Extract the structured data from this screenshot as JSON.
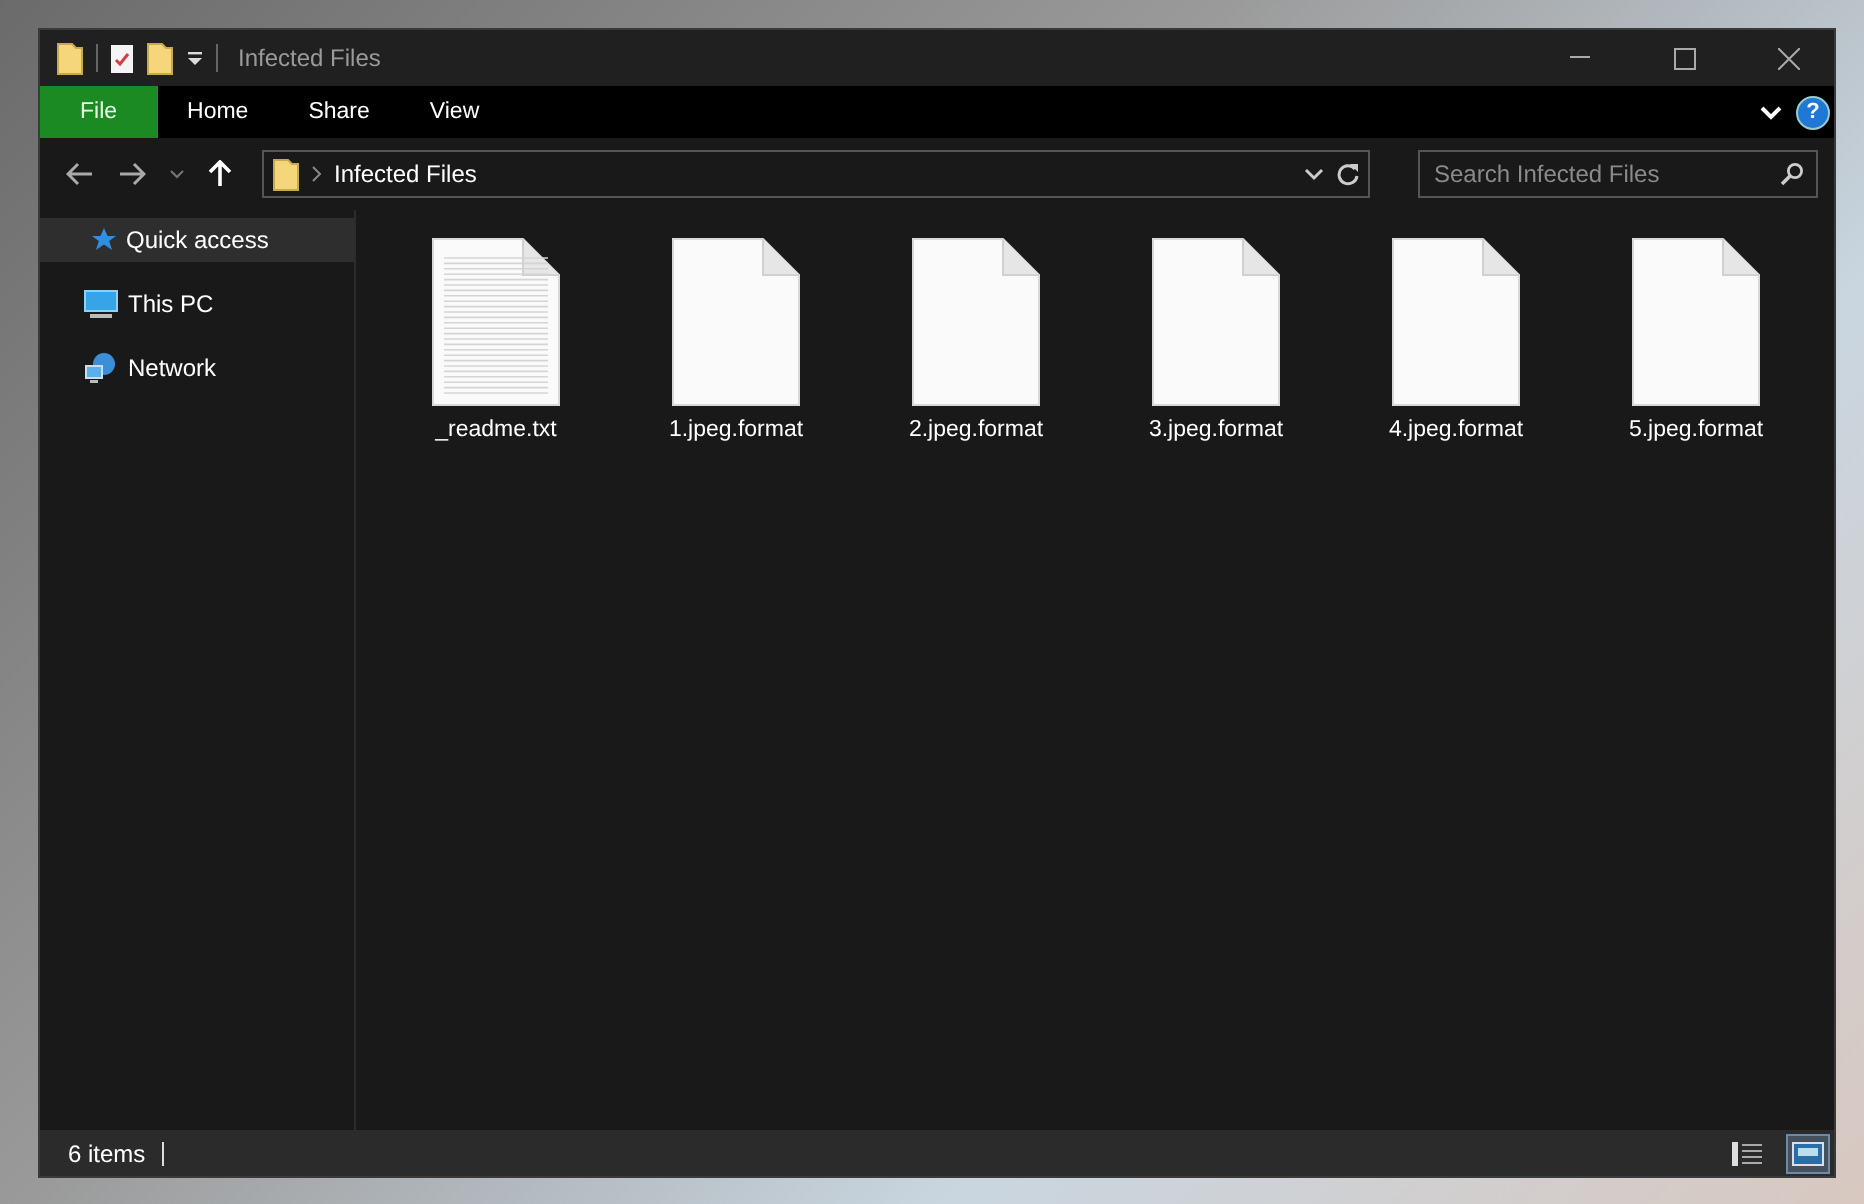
{
  "window": {
    "title": "Infected Files"
  },
  "ribbon": {
    "tabs": [
      {
        "label": "File",
        "selected": true
      },
      {
        "label": "Home",
        "selected": false
      },
      {
        "label": "Share",
        "selected": false
      },
      {
        "label": "View",
        "selected": false
      }
    ],
    "help": "?"
  },
  "address": {
    "path": "Infected Files",
    "search": {
      "placeholder": "Search Infected Files"
    }
  },
  "sidebar": {
    "items": [
      {
        "label": "Quick access",
        "kind": "star",
        "selected": true
      },
      {
        "label": "This PC",
        "kind": "pc",
        "selected": false
      },
      {
        "label": "Network",
        "kind": "network",
        "selected": false
      }
    ]
  },
  "files": [
    {
      "name": "_readme.txt",
      "kind": "text"
    },
    {
      "name": "1.jpeg.format",
      "kind": "blank"
    },
    {
      "name": "2.jpeg.format",
      "kind": "blank"
    },
    {
      "name": "3.jpeg.format",
      "kind": "blank"
    },
    {
      "name": "4.jpeg.format",
      "kind": "blank"
    },
    {
      "name": "5.jpeg.format",
      "kind": "blank"
    }
  ],
  "status_bar": {
    "count": "6 items",
    "views": [
      {
        "kind": "details",
        "selected": false
      },
      {
        "kind": "large",
        "selected": true
      }
    ]
  }
}
